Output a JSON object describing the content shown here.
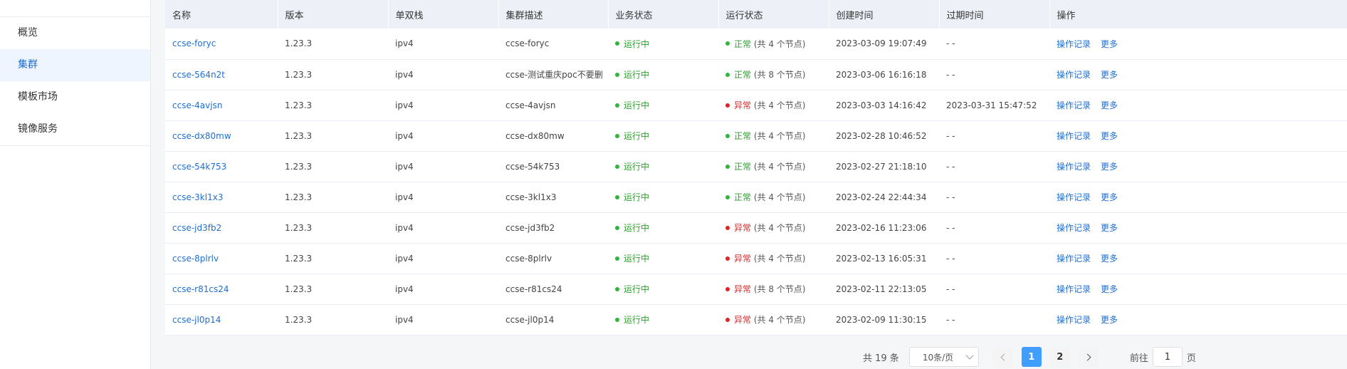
{
  "sidebar": {
    "items": [
      {
        "label": "概览",
        "active": false
      },
      {
        "label": "集群",
        "active": true
      },
      {
        "label": "模板市场",
        "active": false
      },
      {
        "label": "镜像服务",
        "active": false
      }
    ]
  },
  "table": {
    "headers": [
      "名称",
      "版本",
      "单双栈",
      "集群描述",
      "业务状态",
      "运行状态",
      "创建时间",
      "过期时间",
      "操作"
    ],
    "rows": [
      {
        "name": "ccse-foryc",
        "version": "1.23.3",
        "stack": "ipv4",
        "desc": "ccse-foryc",
        "biz": "运行中",
        "run": "正常",
        "run_ok": true,
        "nodes": "(共 4 个节点)",
        "created": "2023-03-09 19:07:49",
        "expire": "- -"
      },
      {
        "name": "ccse-564n2t",
        "version": "1.23.3",
        "stack": "ipv4",
        "desc": "ccse-测试重庆poc不要删",
        "biz": "运行中",
        "run": "正常",
        "run_ok": true,
        "nodes": "(共 8 个节点)",
        "created": "2023-03-06 16:16:18",
        "expire": "- -"
      },
      {
        "name": "ccse-4avjsn",
        "version": "1.23.3",
        "stack": "ipv4",
        "desc": "ccse-4avjsn",
        "biz": "运行中",
        "run": "异常",
        "run_ok": false,
        "nodes": "(共 4 个节点)",
        "created": "2023-03-03 14:16:42",
        "expire": "2023-03-31 15:47:52"
      },
      {
        "name": "ccse-dx80mw",
        "version": "1.23.3",
        "stack": "ipv4",
        "desc": "ccse-dx80mw",
        "biz": "运行中",
        "run": "正常",
        "run_ok": true,
        "nodes": "(共 4 个节点)",
        "created": "2023-02-28 10:46:52",
        "expire": "- -"
      },
      {
        "name": "ccse-54k753",
        "version": "1.23.3",
        "stack": "ipv4",
        "desc": "ccse-54k753",
        "biz": "运行中",
        "run": "正常",
        "run_ok": true,
        "nodes": "(共 4 个节点)",
        "created": "2023-02-27 21:18:10",
        "expire": "- -"
      },
      {
        "name": "ccse-3kl1x3",
        "version": "1.23.3",
        "stack": "ipv4",
        "desc": "ccse-3kl1x3",
        "biz": "运行中",
        "run": "正常",
        "run_ok": true,
        "nodes": "(共 4 个节点)",
        "created": "2023-02-24 22:44:34",
        "expire": "- -"
      },
      {
        "name": "ccse-jd3fb2",
        "version": "1.23.3",
        "stack": "ipv4",
        "desc": "ccse-jd3fb2",
        "biz": "运行中",
        "run": "异常",
        "run_ok": false,
        "nodes": "(共 4 个节点)",
        "created": "2023-02-16 11:23:06",
        "expire": "- -"
      },
      {
        "name": "ccse-8plrlv",
        "version": "1.23.3",
        "stack": "ipv4",
        "desc": "ccse-8plrlv",
        "biz": "运行中",
        "run": "异常",
        "run_ok": false,
        "nodes": "(共 4 个节点)",
        "created": "2023-02-13 16:05:31",
        "expire": "- -"
      },
      {
        "name": "ccse-r81cs24",
        "version": "1.23.3",
        "stack": "ipv4",
        "desc": "ccse-r81cs24",
        "biz": "运行中",
        "run": "异常",
        "run_ok": false,
        "nodes": "(共 8 个节点)",
        "created": "2023-02-11 22:13:05",
        "expire": "- -"
      },
      {
        "name": "ccse-jl0p14",
        "version": "1.23.3",
        "stack": "ipv4",
        "desc": "ccse-jl0p14",
        "biz": "运行中",
        "run": "异常",
        "run_ok": false,
        "nodes": "(共 4 个节点)",
        "created": "2023-02-09 11:30:15",
        "expire": "- -"
      }
    ],
    "actions": {
      "log": "操作记录",
      "more": "更多"
    }
  },
  "pagination": {
    "total": "共 19 条",
    "page_size": "10条/页",
    "pages": [
      "1",
      "2"
    ],
    "current": "1",
    "goto_prefix": "前往",
    "goto_value": "1",
    "goto_suffix": "页"
  },
  "colors": {
    "accent": "#1f6fd1",
    "ok": "#2fb53a",
    "error": "#e02424",
    "page_active": "#409eff"
  }
}
